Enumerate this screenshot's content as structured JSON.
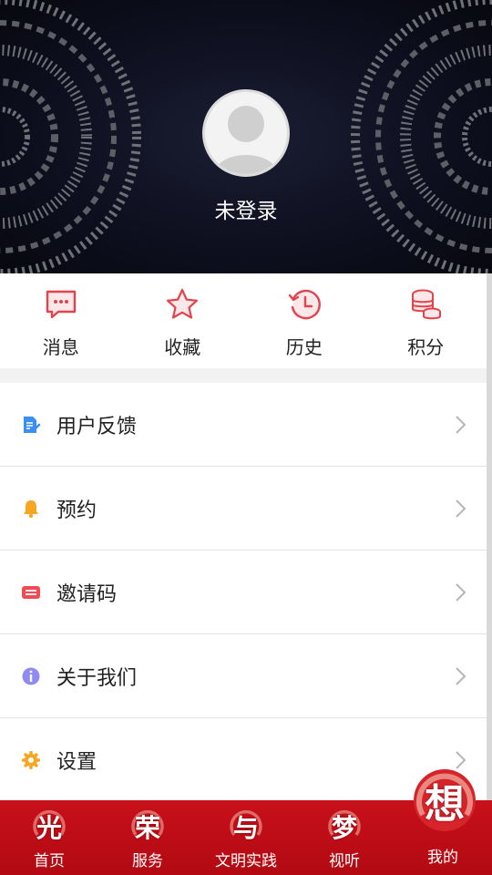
{
  "header": {
    "login_status": "未登录"
  },
  "quick_actions": [
    {
      "label": "消息",
      "icon": "message-icon"
    },
    {
      "label": "收藏",
      "icon": "star-icon"
    },
    {
      "label": "历史",
      "icon": "history-icon"
    },
    {
      "label": "积分",
      "icon": "coins-icon"
    }
  ],
  "menu": [
    {
      "label": "用户反馈",
      "icon": "feedback-icon",
      "color": "#3b8ff0"
    },
    {
      "label": "预约",
      "icon": "bell-icon",
      "color": "#f5a623"
    },
    {
      "label": "邀请码",
      "icon": "ticket-icon",
      "color": "#ee4b55"
    },
    {
      "label": "关于我们",
      "icon": "info-icon",
      "color": "#8f8bf2"
    },
    {
      "label": "设置",
      "icon": "gear-icon",
      "color": "#f5a623"
    }
  ],
  "tabbar": [
    {
      "glyph": "光",
      "label": "首页"
    },
    {
      "glyph": "荣",
      "label": "服务"
    },
    {
      "glyph": "与",
      "label": "文明实践"
    },
    {
      "glyph": "梦",
      "label": "视听"
    },
    {
      "glyph": "想",
      "label": "我的",
      "active": true
    }
  ],
  "colors": {
    "accent": "#e3434c",
    "tabbar_bg": "#c8101a"
  }
}
